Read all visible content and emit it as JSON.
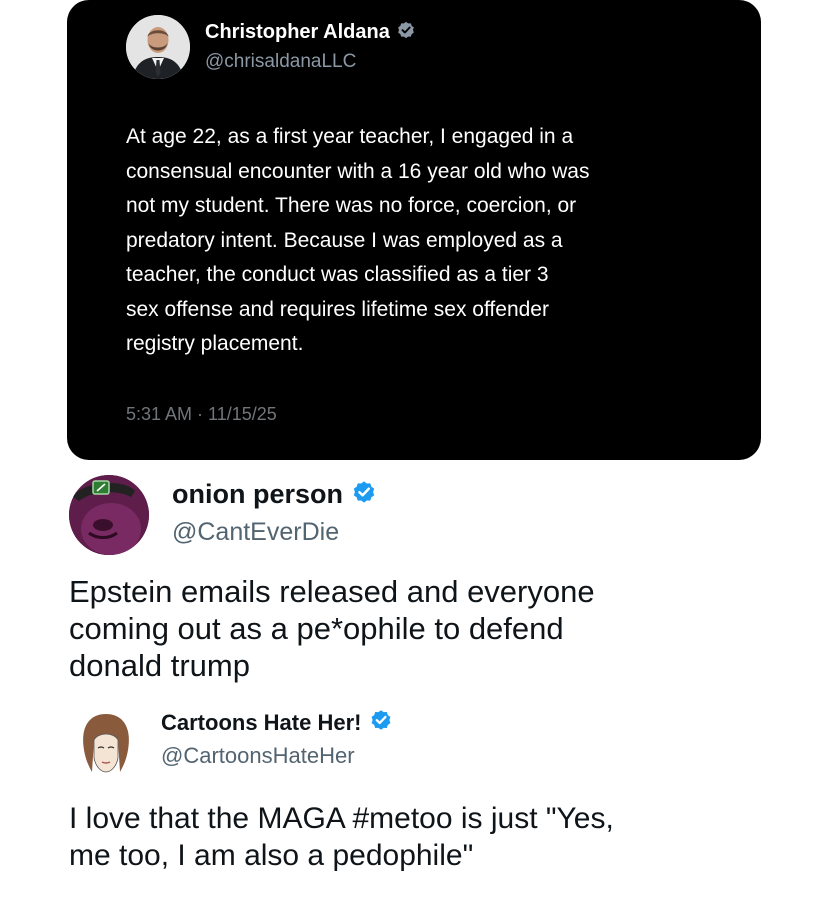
{
  "quoted_tweet": {
    "author_name": "Christopher Aldana",
    "author_handle": "@chrisaldanaLLC",
    "verified_badge_color": "#8b98a5",
    "body_lines": [
      "At age 22, as a first year teacher, I engaged in a",
      "consensual encounter with a 16 year old who was",
      "not my student. There was no force, coercion, or",
      "predatory intent. Because I was employed as a",
      "teacher, the conduct was classified as a tier 3",
      "sex offense and requires lifetime sex offender",
      "registry placement."
    ],
    "timestamp": "5:31 AM · 11/15/25"
  },
  "reply_tweet_1": {
    "author_name": "onion person",
    "author_handle": "@CantEverDie",
    "verified_badge_color": "#1d9bf0",
    "body_lines": [
      "Epstein emails released and everyone",
      "coming out as a pe*ophile to defend",
      "donald trump"
    ]
  },
  "reply_tweet_2": {
    "author_name": "Cartoons Hate Her!",
    "author_handle": "@CartoonsHateHer",
    "verified_badge_color": "#1d9bf0",
    "body_lines": [
      "I love that the MAGA #metoo is just \"Yes,",
      "me too, I am also a pedophile\""
    ]
  },
  "icons": {
    "verified": "verified-badge-icon",
    "avatar_1": "man-in-suit-avatar",
    "avatar_2": "purple-onion-avatar",
    "avatar_3": "cartoon-woman-avatar"
  }
}
